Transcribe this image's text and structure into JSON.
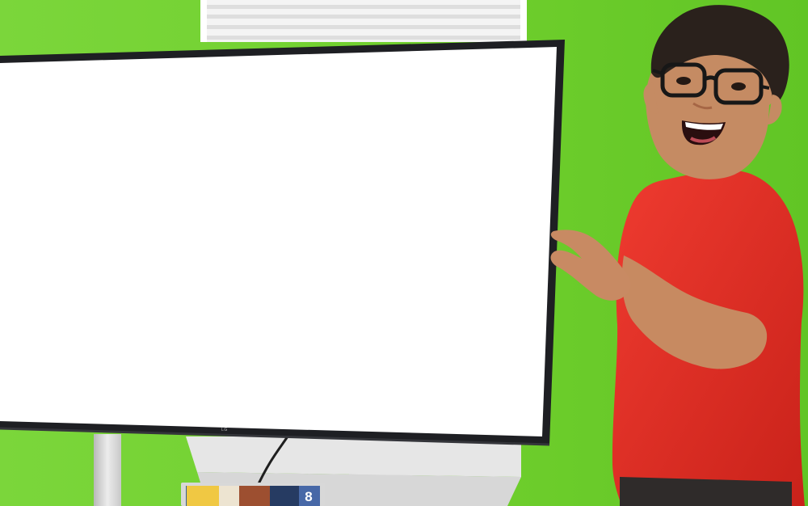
{
  "scene": {
    "tv_brand_text": "LG",
    "device_screen_number": "8"
  },
  "colors": {
    "background": "#6dd12a",
    "screen": "#ffffff",
    "tv_bezel": "#1f1f22",
    "shirt": "#e13126",
    "skin": "#c48a61",
    "hair": "#2c211c",
    "glasses": "#171717",
    "blinds": "#f6f6f6",
    "stand": "#dcdcdc"
  }
}
